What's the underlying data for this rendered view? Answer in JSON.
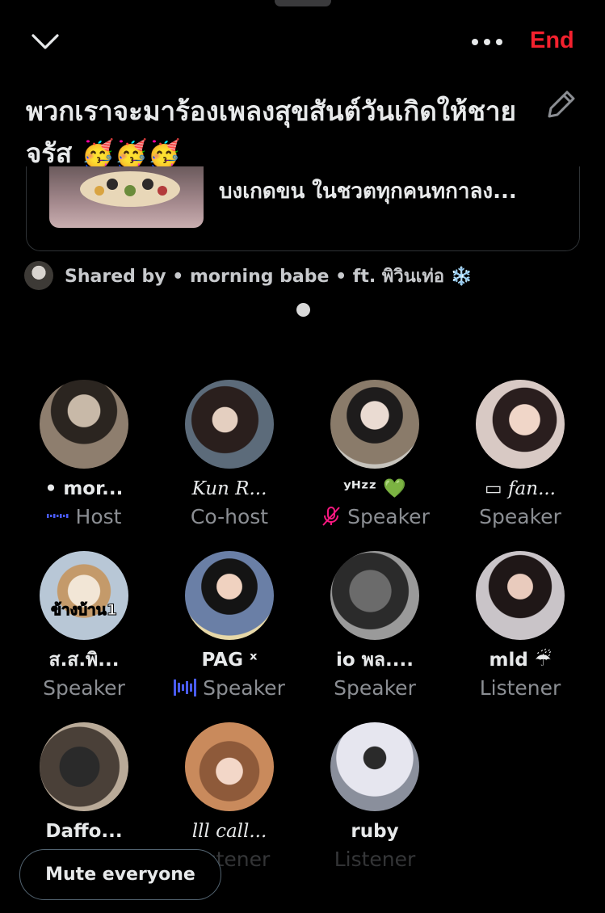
{
  "header": {
    "end_label": "End",
    "title": "พวกเราจะมาร้องเพลงสุขสันต์วันเกิดให้ชายจรัส 🥳🥳🥳"
  },
  "shared_card": {
    "text": "บงเกดขน ในชวตทุกคนทกาลง..."
  },
  "shared_by": {
    "text": "Shared by • morning babe • ft. พิวินเท่อ ❄️"
  },
  "participants": [
    {
      "name": "• mor...",
      "role": "Host",
      "indicator": "speaking",
      "style": "bold"
    },
    {
      "name": "Kun R...",
      "role": "Co-host",
      "indicator": "none",
      "style": "italic"
    },
    {
      "name": "ʸᴴᶻᶻ 💚",
      "role": "Speaker",
      "indicator": "muted",
      "style": "bold"
    },
    {
      "name": "▭ fan...",
      "role": "Speaker",
      "indicator": "none",
      "style": "italic"
    },
    {
      "name": "ส.ส.พิ...",
      "role": "Speaker",
      "indicator": "none",
      "style": "bold",
      "avatar_text": "ข้างบ้าน1"
    },
    {
      "name": "PAG ˣ",
      "role": "Speaker",
      "indicator": "speaking-bars",
      "style": "bold"
    },
    {
      "name": "io พล....",
      "role": "Speaker",
      "indicator": "none",
      "style": "bold"
    },
    {
      "name": "mld ☔",
      "role": "Listener",
      "indicator": "none",
      "style": "bold"
    },
    {
      "name": "Daffo...",
      "role": "Listener",
      "indicator": "none",
      "style": "bold"
    },
    {
      "name": "lll call...",
      "role": "Listener",
      "indicator": "none",
      "style": "italic"
    },
    {
      "name": "ruby",
      "role": "Listener",
      "indicator": "none",
      "style": "bold"
    }
  ],
  "footer": {
    "mute_label": "Mute everyone"
  },
  "colors": {
    "accent_red": "#f4212e",
    "speaking_blue": "#4a5cff",
    "muted_pink": "#f91880",
    "secondary_text": "#8b8e93"
  }
}
